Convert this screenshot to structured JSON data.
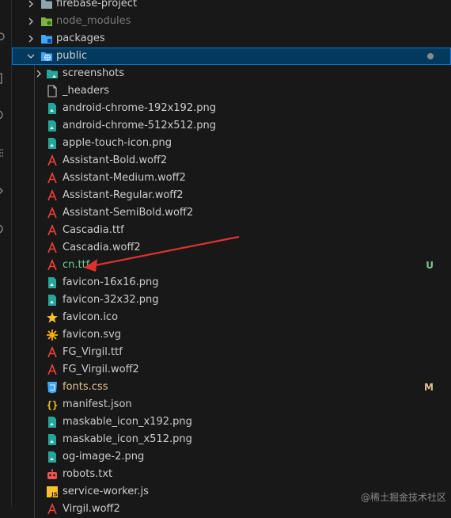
{
  "explorer": {
    "folders": {
      "firebase_project": "firebase-project",
      "node_modules": "node_modules",
      "packages": "packages",
      "public": "public",
      "screenshots": "screenshots"
    },
    "files": [
      {
        "label": "_headers",
        "icon": "generic-file-icon",
        "color": "default"
      },
      {
        "label": "android-chrome-192x192.png",
        "icon": "image-file-icon",
        "color": "default"
      },
      {
        "label": "android-chrome-512x512.png",
        "icon": "image-file-icon",
        "color": "default"
      },
      {
        "label": "apple-touch-icon.png",
        "icon": "image-file-icon",
        "color": "default"
      },
      {
        "label": "Assistant-Bold.woff2",
        "icon": "font-file-icon",
        "color": "default"
      },
      {
        "label": "Assistant-Medium.woff2",
        "icon": "font-file-icon",
        "color": "default"
      },
      {
        "label": "Assistant-Regular.woff2",
        "icon": "font-file-icon",
        "color": "default"
      },
      {
        "label": "Assistant-SemiBold.woff2",
        "icon": "font-file-icon",
        "color": "default"
      },
      {
        "label": "Cascadia.ttf",
        "icon": "font-file-icon",
        "color": "default"
      },
      {
        "label": "Cascadia.woff2",
        "icon": "font-file-icon",
        "color": "default"
      },
      {
        "label": "cn.ttf",
        "icon": "font-file-icon",
        "color": "untracked",
        "badge": "U"
      },
      {
        "label": "favicon-16x16.png",
        "icon": "image-file-icon",
        "color": "default"
      },
      {
        "label": "favicon-32x32.png",
        "icon": "image-file-icon",
        "color": "default"
      },
      {
        "label": "favicon.ico",
        "icon": "star-icon",
        "color": "default"
      },
      {
        "label": "favicon.svg",
        "icon": "svg-file-icon",
        "color": "default"
      },
      {
        "label": "FG_Virgil.ttf",
        "icon": "font-file-icon",
        "color": "default"
      },
      {
        "label": "FG_Virgil.woff2",
        "icon": "font-file-icon",
        "color": "default"
      },
      {
        "label": "fonts.css",
        "icon": "css-file-icon",
        "color": "modified",
        "badge": "M"
      },
      {
        "label": "manifest.json",
        "icon": "json-file-icon",
        "color": "default"
      },
      {
        "label": "maskable_icon_x192.png",
        "icon": "image-file-icon",
        "color": "default"
      },
      {
        "label": "maskable_icon_x512.png",
        "icon": "image-file-icon",
        "color": "default"
      },
      {
        "label": "og-image-2.png",
        "icon": "image-file-icon",
        "color": "default"
      },
      {
        "label": "robots.txt",
        "icon": "robot-file-icon",
        "color": "default"
      },
      {
        "label": "service-worker.js",
        "icon": "js-file-icon",
        "color": "default"
      },
      {
        "label": "Virgil.woff2",
        "icon": "font-file-icon",
        "color": "default"
      }
    ]
  },
  "colors": {
    "background": "#181818",
    "selection": "#04395e",
    "focus_border": "#0078d4",
    "untracked": "#73c991",
    "modified": "#e2c08d",
    "annotation_arrow": "#e03131"
  },
  "watermark": "@稀土掘金技术社区"
}
